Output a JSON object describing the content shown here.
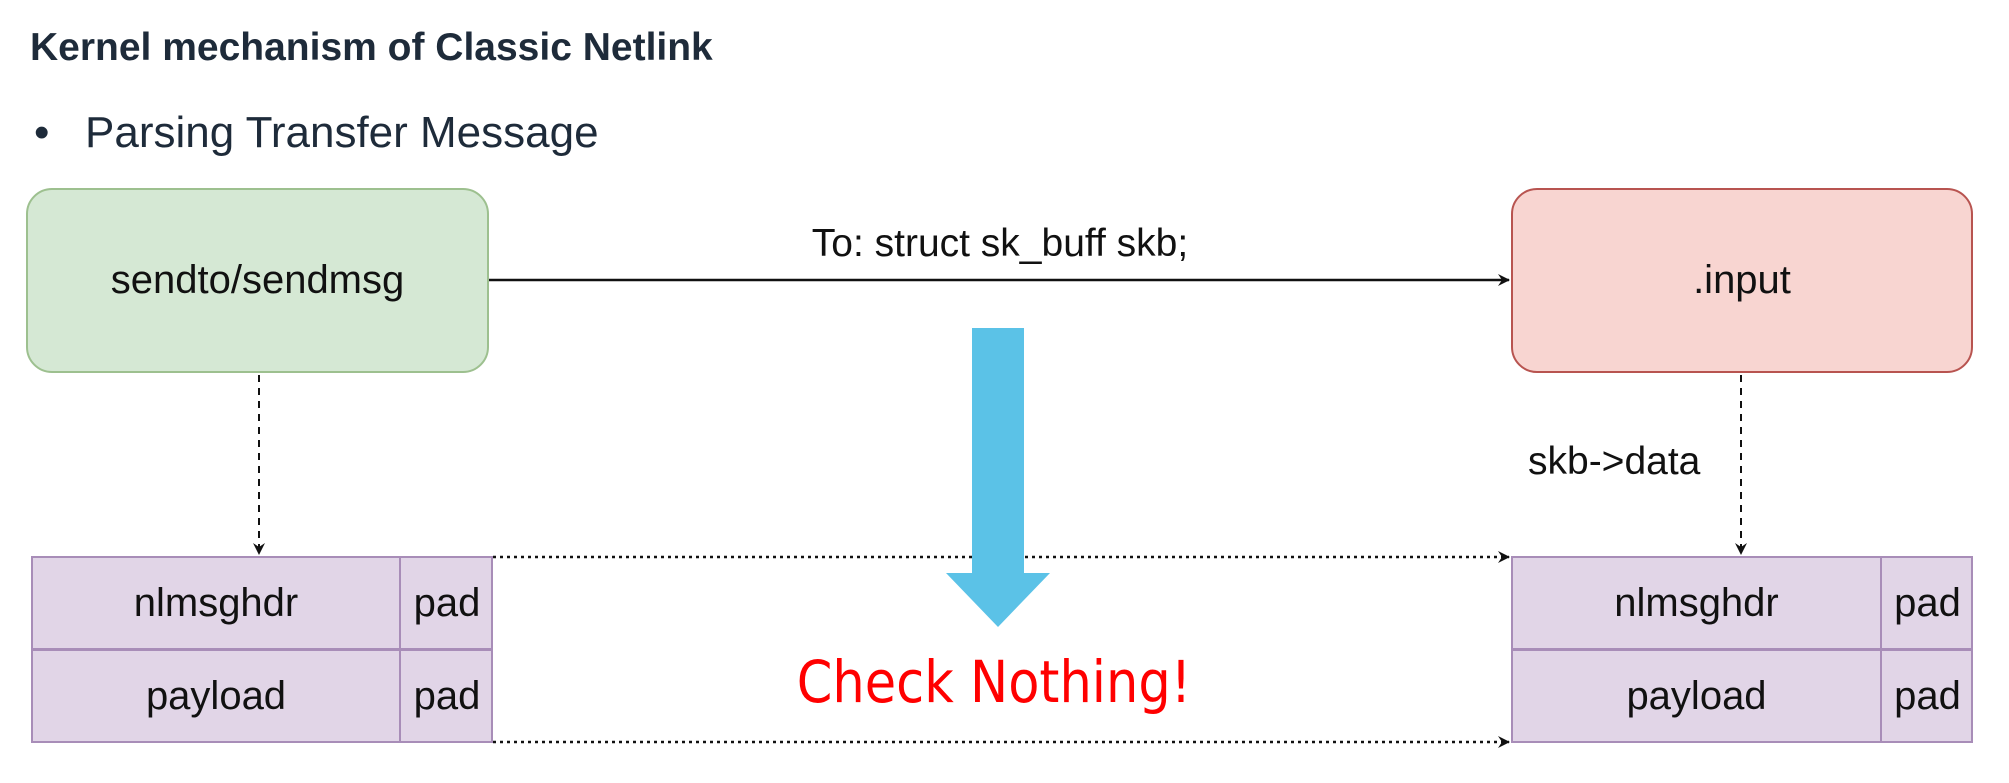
{
  "title": "Kernel mechanism of Classic Netlink",
  "bullet": {
    "marker": "•",
    "text": "Parsing Transfer Message"
  },
  "nodes": {
    "sender": "sendto/sendmsg",
    "receiver": ".input"
  },
  "edges": {
    "transfer_label": "To: struct sk_buff skb;",
    "receiver_data_label": "skb->data"
  },
  "left_table": {
    "rows": [
      {
        "field": "nlmsghdr",
        "pad": "pad"
      },
      {
        "field": "payload",
        "pad": "pad"
      }
    ]
  },
  "right_table": {
    "rows": [
      {
        "field": "nlmsghdr",
        "pad": "pad"
      },
      {
        "field": "payload",
        "pad": "pad"
      }
    ]
  },
  "callout": "Check Nothing!",
  "colors": {
    "sender_fill": "#d5e8d4",
    "receiver_fill": "#f8d5d1",
    "table_fill": "#e1d5e7",
    "big_arrow": "#5bc2e7",
    "callout": "#ff0000"
  }
}
